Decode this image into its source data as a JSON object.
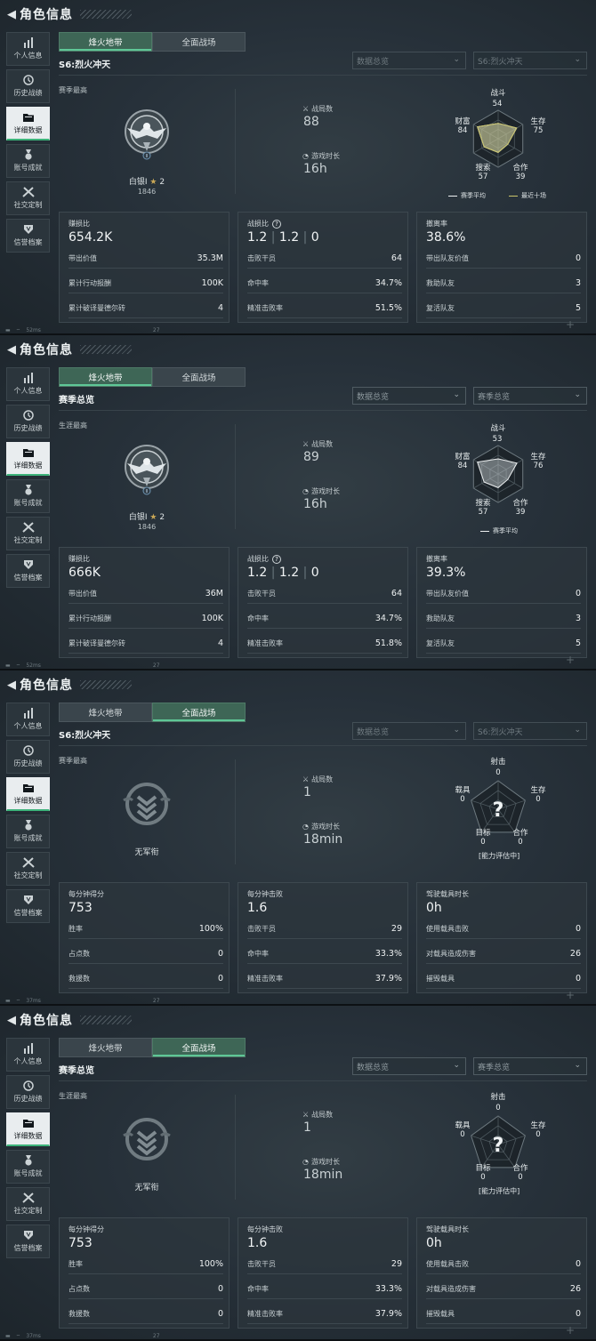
{
  "common": {
    "title": "角色信息",
    "sidebar": [
      {
        "icon": "bar-chart-icon",
        "label": "个人信息"
      },
      {
        "icon": "history-icon",
        "label": "历史战绩"
      },
      {
        "icon": "folder-icon",
        "label": "详细数据",
        "active": true
      },
      {
        "icon": "medal-icon",
        "label": "账号成就"
      },
      {
        "icon": "tools-icon",
        "label": "社交定制"
      },
      {
        "icon": "badge-icon",
        "label": "信誉档案"
      }
    ],
    "tabs": [
      "烽火地带",
      "全面战场"
    ],
    "filter1": "数据总览"
  },
  "panels": [
    {
      "active_tab": 0,
      "status": {
        "ping": "52ms",
        "num": "27"
      },
      "season": "S6:烈火冲天",
      "season_bright": true,
      "filter2": "S6:烈火冲天",
      "filter_dim": true,
      "best_label": "赛季最高",
      "emblem": "silver",
      "rank_name": "白银I",
      "rank_stars": "2",
      "rank_score": "1846",
      "m1_label": "战局数",
      "m1_value": "88",
      "m2_label": "游戏时长",
      "m2_value": "16h",
      "radar": {
        "type": "hex",
        "labels": [
          "战斗",
          "生存",
          "合作",
          "搜索",
          "财富"
        ],
        "values": [
          "54",
          "75",
          "39",
          "57",
          "84"
        ],
        "series": [
          {
            "name": "赛季平均",
            "color": "#eef1f2"
          },
          {
            "name": "最近十场",
            "color": "#c9c46a"
          }
        ]
      },
      "cards": [
        {
          "title": "赚损比",
          "value": "654.2K",
          "rows": [
            [
              "带出价值",
              "35.3M"
            ],
            [
              "累计行动报酬",
              "100K"
            ],
            [
              "累计破译曼德尔砖",
              "4"
            ]
          ]
        },
        {
          "title": "战损比",
          "help": true,
          "value_parts": [
            "1.2",
            "1.2",
            "0"
          ],
          "rows": [
            [
              "击败干员",
              "64"
            ],
            [
              "命中率",
              "34.7%"
            ],
            [
              "精准击败率",
              "51.5%"
            ]
          ]
        },
        {
          "title": "撤离率",
          "value": "38.6%",
          "rows": [
            [
              "带出队友价值",
              "0"
            ],
            [
              "救助队友",
              "3"
            ],
            [
              "复活队友",
              "5"
            ]
          ]
        }
      ]
    },
    {
      "active_tab": 0,
      "status": {
        "ping": "52ms",
        "num": "27"
      },
      "season": "赛季总览",
      "season_bright": true,
      "filter2": "赛季总览",
      "filter_dim": false,
      "best_label": "生涯最高",
      "emblem": "silver",
      "rank_name": "白银I",
      "rank_stars": "2",
      "rank_score": "1846",
      "m1_label": "战局数",
      "m1_value": "89",
      "m2_label": "游戏时长",
      "m2_value": "16h",
      "radar": {
        "type": "hex",
        "labels": [
          "战斗",
          "生存",
          "合作",
          "搜索",
          "财富"
        ],
        "values": [
          "53",
          "76",
          "39",
          "57",
          "84"
        ],
        "series": [
          {
            "name": "赛季平均",
            "color": "#eef1f2"
          }
        ]
      },
      "cards": [
        {
          "title": "赚损比",
          "value": "666K",
          "rows": [
            [
              "带出价值",
              "36M"
            ],
            [
              "累计行动报酬",
              "100K"
            ],
            [
              "累计破译曼德尔砖",
              "4"
            ]
          ]
        },
        {
          "title": "战损比",
          "help": true,
          "value_parts": [
            "1.2",
            "1.2",
            "0"
          ],
          "rows": [
            [
              "击败干员",
              "64"
            ],
            [
              "命中率",
              "34.7%"
            ],
            [
              "精准击败率",
              "51.8%"
            ]
          ]
        },
        {
          "title": "撤离率",
          "value": "39.3%",
          "rows": [
            [
              "带出队友价值",
              "0"
            ],
            [
              "救助队友",
              "3"
            ],
            [
              "复活队友",
              "5"
            ]
          ]
        }
      ]
    },
    {
      "active_tab": 1,
      "status": {
        "ping": "37ms",
        "num": "27"
      },
      "season": "S6:烈火冲天",
      "season_bright": true,
      "filter2": "S6:烈火冲天",
      "filter_dim": true,
      "best_label": "赛季最高",
      "emblem": "none",
      "rank_name": "无军衔",
      "m1_label": "战局数",
      "m1_value": "1",
      "m2_label": "游戏时长",
      "m2_value": "18min",
      "radar": {
        "type": "pent",
        "labels": [
          "射击",
          "生存",
          "合作",
          "目标",
          "载具"
        ],
        "values": [
          "0",
          "0",
          "0",
          "0",
          "0"
        ],
        "note": "[能力评估中]"
      },
      "cards": [
        {
          "title": "每分钟得分",
          "value": "753",
          "rows": [
            [
              "胜率",
              "100%"
            ],
            [
              "占点数",
              "0"
            ],
            [
              "救援数",
              "0"
            ]
          ]
        },
        {
          "title": "每分钟击败",
          "value": "1.6",
          "rows": [
            [
              "击败干员",
              "29"
            ],
            [
              "命中率",
              "33.3%"
            ],
            [
              "精准击败率",
              "37.9%"
            ]
          ]
        },
        {
          "title": "驾驶载具时长",
          "value": "0h",
          "rows": [
            [
              "使用载具击败",
              "0"
            ],
            [
              "对载具造成伤害",
              "26"
            ],
            [
              "摧毁载具",
              "0"
            ]
          ]
        }
      ]
    },
    {
      "active_tab": 1,
      "status": {
        "ping": "37ms",
        "num": "27"
      },
      "season": "赛季总览",
      "season_bright": true,
      "filter2": "赛季总览",
      "filter_dim": false,
      "best_label": "生涯最高",
      "emblem": "none",
      "rank_name": "无军衔",
      "m1_label": "战局数",
      "m1_value": "1",
      "m2_label": "游戏时长",
      "m2_value": "18min",
      "radar": {
        "type": "pent",
        "labels": [
          "射击",
          "生存",
          "合作",
          "目标",
          "载具"
        ],
        "values": [
          "0",
          "0",
          "0",
          "0",
          "0"
        ],
        "note": "[能力评估中]"
      },
      "cards": [
        {
          "title": "每分钟得分",
          "value": "753",
          "rows": [
            [
              "胜率",
              "100%"
            ],
            [
              "占点数",
              "0"
            ],
            [
              "救援数",
              "0"
            ]
          ]
        },
        {
          "title": "每分钟击败",
          "value": "1.6",
          "rows": [
            [
              "击败干员",
              "29"
            ],
            [
              "命中率",
              "33.3%"
            ],
            [
              "精准击败率",
              "37.9%"
            ]
          ]
        },
        {
          "title": "驾驶载具时长",
          "value": "0h",
          "rows": [
            [
              "使用载具击败",
              "0"
            ],
            [
              "对载具造成伤害",
              "26"
            ],
            [
              "摧毁载具",
              "0"
            ]
          ]
        }
      ]
    }
  ]
}
